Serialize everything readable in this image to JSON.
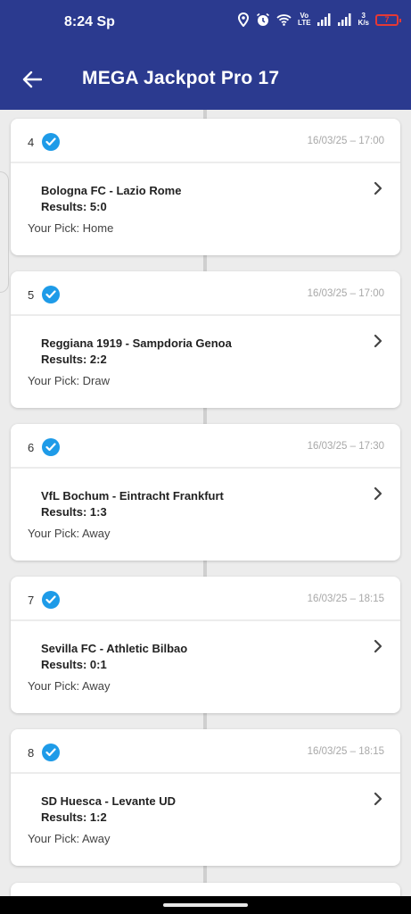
{
  "status_bar": {
    "time": "8:24",
    "carrier_badge": "Sp",
    "net_top": "Vo",
    "net_bottom": "LTE",
    "speed_top": "3",
    "speed_bottom": "K/s",
    "battery": "7",
    "battery_color": "#e53935"
  },
  "header": {
    "title": "MEGA Jackpot Pro 17",
    "back_icon": "arrow-left-icon",
    "background": "#2b3a8f"
  },
  "accent_color": "#1e9be8",
  "picks": [
    {
      "number": "4",
      "datetime": "16/03/25 – 17:00",
      "match": "Bologna FC - Lazio Rome",
      "result": "Results: 5:0",
      "pick": "Your Pick: Home"
    },
    {
      "number": "5",
      "datetime": "16/03/25 – 17:00",
      "match": "Reggiana 1919 - Sampdoria Genoa",
      "result": "Results: 2:2",
      "pick": "Your Pick: Draw"
    },
    {
      "number": "6",
      "datetime": "16/03/25 – 17:30",
      "match": "VfL Bochum - Eintracht Frankfurt",
      "result": "Results: 1:3",
      "pick": "Your Pick: Away"
    },
    {
      "number": "7",
      "datetime": "16/03/25 – 18:15",
      "match": "Sevilla FC - Athletic Bilbao",
      "result": "Results: 0:1",
      "pick": "Your Pick: Away"
    },
    {
      "number": "8",
      "datetime": "16/03/25 – 18:15",
      "match": "SD Huesca - Levante UD",
      "result": "Results: 1:2",
      "pick": "Your Pick: Away"
    }
  ]
}
